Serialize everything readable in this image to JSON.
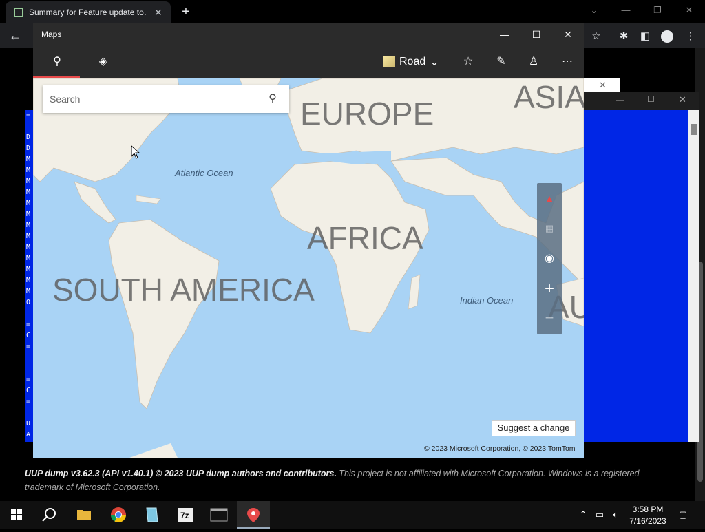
{
  "browser": {
    "tab_title": "Summary for Feature update to A",
    "tab_close": "✕",
    "new_tab": "+",
    "back": "←"
  },
  "console": {
    "left_chars": [
      "=",
      "",
      "D",
      "D",
      "M",
      "M",
      "M",
      "M",
      "M",
      "M",
      "M",
      "M",
      "M",
      "M",
      "M",
      "M",
      "M",
      "O",
      "",
      "=",
      "C",
      "=",
      "",
      "",
      "=",
      "C",
      "=",
      "",
      "U",
      "A"
    ]
  },
  "page": {
    "footer_bold": "UUP dump v3.62.3 (API v1.40.1) © 2023 UUP dump authors and contributors.",
    "footer_rest": " This project is not affiliated with Microsoft Corporation. Windows is a registered trademark of Microsoft Corporation."
  },
  "maps": {
    "title": "Maps",
    "style_label": "Road",
    "search_placeholder": "Search",
    "labels": {
      "europe": "EUROPE",
      "asia": "ASIA",
      "africa": "AFRICA",
      "south_america": "SOUTH AMERICA",
      "australia": "AU",
      "atlantic": "Atlantic Ocean",
      "indian": "Indian Ocean"
    },
    "suggest": "Suggest a change",
    "copyright": "© 2023 Microsoft Corporation, © 2023 TomTom"
  },
  "taskbar": {
    "time": "3:58 PM",
    "date": "7/16/2023"
  },
  "colors": {
    "ocean": "#a9d3f5",
    "land": "#f2efe6",
    "console_blue": "#0026e6",
    "accent_red": "#e84a4a"
  }
}
